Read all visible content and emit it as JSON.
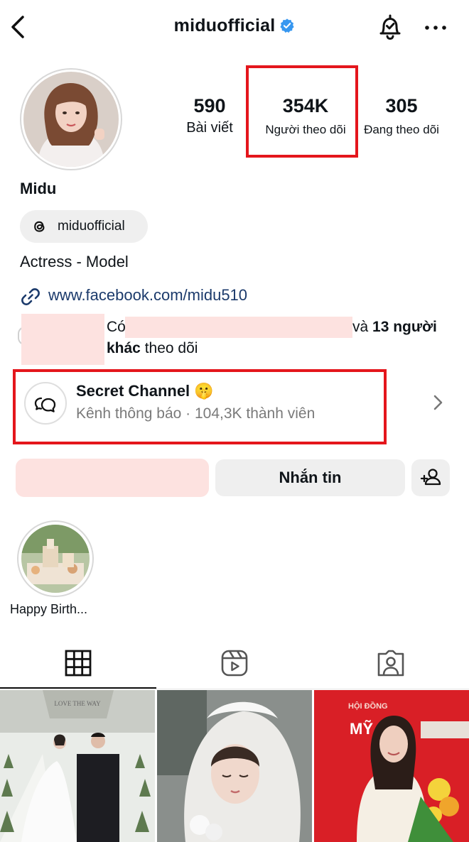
{
  "header": {
    "username": "miduofficial",
    "icons": {
      "back": "chevron-left-icon",
      "verified": "verified-badge-icon",
      "bell": "bell-check-icon",
      "more": "more-horizontal-icon"
    },
    "verified_color": "#3797f0"
  },
  "profile": {
    "stats": [
      {
        "value": "590",
        "label": "Bài viết"
      },
      {
        "value": "354K",
        "label": "Người theo dõi"
      },
      {
        "value": "305",
        "label": "Đang theo dõi"
      }
    ],
    "name": "Midu",
    "threads_handle": "miduofficial",
    "bio": "Actress - Model",
    "link": "www.facebook.com/midu510",
    "link_color": "#1b3a6b",
    "followed_by": {
      "prefix": "Có",
      "middle": "và",
      "bold_part": "13 người",
      "bold_part2": "khác",
      "suffix": "theo dõi"
    }
  },
  "channel": {
    "title": "Secret Channel 🤫",
    "subtitle": "Kênh thông báo · 104,3K thành viên"
  },
  "actions": {
    "message_label": "Nhắn tin"
  },
  "highlights": [
    {
      "label": "Happy Birth..."
    }
  ],
  "tabs": [
    {
      "name": "grid-icon"
    },
    {
      "name": "reels-icon"
    },
    {
      "name": "tagged-icon"
    }
  ],
  "posts": [
    {
      "text": "LOVE THE WAY",
      "sub": ""
    },
    {
      "text": "",
      "sub": ""
    },
    {
      "text": "HỘI ĐỒNG",
      "sub": "MỸ"
    }
  ],
  "annotation_color": "#e4161c",
  "redaction_color": "#fde2e0"
}
